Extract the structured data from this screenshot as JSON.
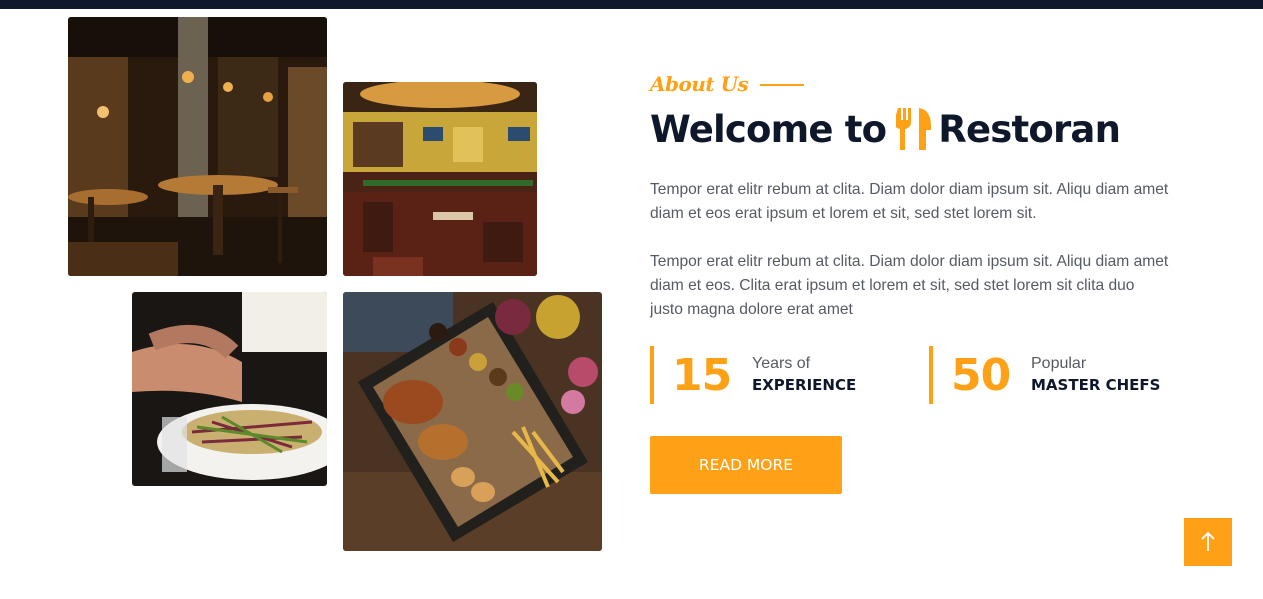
{
  "about": {
    "eyebrow": "About Us",
    "title_before": "Welcome to",
    "title_brand": "Restoran",
    "paragraphs": [
      "Tempor erat elitr rebum at clita. Diam dolor diam ipsum sit. Aliqu diam amet diam et eos erat ipsum et lorem et sit, sed stet lorem sit.",
      "Tempor erat elitr rebum at clita. Diam dolor diam ipsum sit. Aliqu diam amet diam et eos. Clita erat ipsum et lorem et sit, sed stet lorem sit clita duo justo magna dolore erat amet"
    ],
    "stats": [
      {
        "number": "15",
        "line1": "Years of",
        "line2": "EXPERIENCE"
      },
      {
        "number": "50",
        "line1": "Popular",
        "line2": "MASTER CHEFS"
      }
    ],
    "button_label": "READ MORE"
  },
  "images": [
    {
      "name": "restaurant-interior-bar"
    },
    {
      "name": "restaurant-dining-room"
    },
    {
      "name": "salad-plate"
    },
    {
      "name": "grilled-food-platter"
    }
  ],
  "icons": {
    "brand": "utensils-icon",
    "back_to_top": "arrow-up-icon"
  },
  "colors": {
    "accent": "#fea116",
    "dark": "#0f172b",
    "text": "#555a63"
  }
}
